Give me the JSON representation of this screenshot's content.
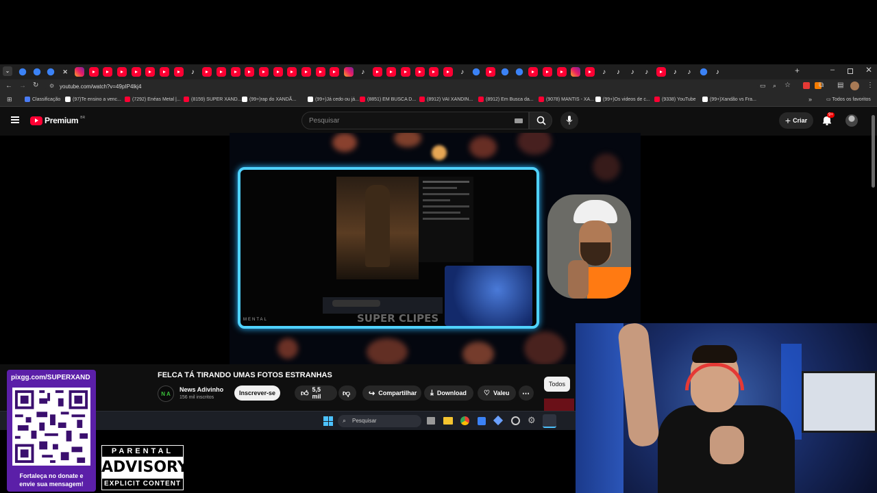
{
  "browser": {
    "url": "youtube.com/watch?v=49pIP4lkj4",
    "bookmarks": [
      {
        "label": "Classificação",
        "color": "#4a7cf5"
      },
      {
        "label": "(97)Te ensino a venc...",
        "color": "#ffffff"
      },
      {
        "label": "(7292) Enéas Metal |...",
        "color": "#ff0033"
      },
      {
        "label": "(8159) SUPER XAND...",
        "color": "#ff0033"
      },
      {
        "label": "(99+)rap do XANDÃ...",
        "color": "#ffffff"
      },
      {
        "label": "(99+)Já cedo ou já...",
        "color": "#ffffff"
      },
      {
        "label": "(8851) EM BUSCA D...",
        "color": "#ff0033"
      },
      {
        "label": "(8912) VAI XANDIN...",
        "color": "#ff0033"
      },
      {
        "label": "(8912) Em Busca da...",
        "color": "#ff0033"
      },
      {
        "label": "(9078) MANTIS - XA...",
        "color": "#ff0033"
      },
      {
        "label": "(99+)Os videos de c...",
        "color": "#ffffff"
      },
      {
        "label": "(9338) YouTube",
        "color": "#ff0033"
      },
      {
        "label": "(99+)Xandão vs Fra...",
        "color": "#ffffff"
      }
    ],
    "all_favorites": "Todos os favoritos"
  },
  "youtube": {
    "logo": "Premium",
    "logo_region": "BR",
    "search_placeholder": "Pesquisar",
    "create_label": "Criar",
    "notif_count": "9+"
  },
  "player": {
    "overlay_text": "SUPER CLIPES",
    "corner_text": "MENTAL",
    "taskbar_search": "Pesquisar"
  },
  "video": {
    "title": "FELCA TÁ TIRANDO UMAS FOTOS ESTRANHAS",
    "channel_name": "News Adivinho",
    "channel_avatar": "N A",
    "subscribers": "156 mil inscritos",
    "subscribe_label": "Inscrever-se",
    "likes": "5,5 mil",
    "share_label": "Compartilhar",
    "download_label": "Download",
    "thanks_label": "Valeu",
    "chip_all": "Todos"
  },
  "taskbar": {
    "search_label": "Pesquisar"
  },
  "overlay": {
    "donate_url": "pixgg.com/SUPERXAND",
    "donate_text_1": "Fortaleça no donate e",
    "donate_text_2": "envie sua mensagem!",
    "advisory_top": "PARENTAL",
    "advisory_mid": "ADVISORY",
    "advisory_bottom": "EXPLICIT CONTENT"
  }
}
